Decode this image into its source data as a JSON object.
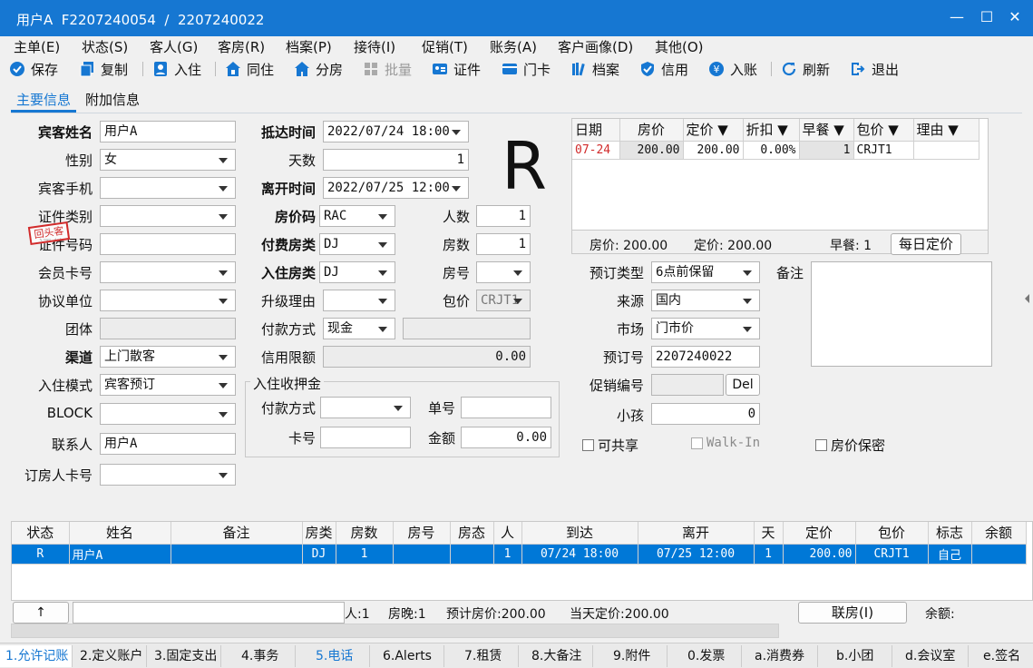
{
  "window": {
    "title": "用户A  F2207240054  /  2207240022",
    "min": "—",
    "max": "☐",
    "close": "✕"
  },
  "menu": [
    "主单(E)",
    "状态(S)",
    "客人(G)",
    "客房(R)",
    "档案(P)",
    "接待(I)",
    "促销(T)",
    "账务(A)",
    "客户画像(D)",
    "其他(O)"
  ],
  "toolbar": {
    "save": "保存",
    "copy": "复制",
    "checkin": "入住",
    "share": "同住",
    "split": "分房",
    "batch": "批量",
    "certificate": "证件",
    "card": "门卡",
    "profile": "档案",
    "credit": "信用",
    "post": "入账",
    "refresh": "刷新",
    "exit": "退出"
  },
  "tabs": {
    "main": "主要信息",
    "extra": "附加信息"
  },
  "form": {
    "guest_name_label": "宾客姓名",
    "guest_name": "用户A",
    "gender_label": "性别",
    "gender": "女",
    "phone_label": "宾客手机",
    "phone": "",
    "idtype_label": "证件类别",
    "idtype": "",
    "idno_label": "证件号码",
    "idno": "",
    "member_label": "会员卡号",
    "member": "",
    "company_label": "协议单位",
    "company": "",
    "group_label": "团体",
    "group": "",
    "channel_label": "渠道",
    "channel": "上门散客",
    "mode_label": "入住模式",
    "mode": "宾客预订",
    "block_label": "BLOCK",
    "block": "",
    "contact_label": "联系人",
    "contact": "用户A",
    "booker_label": "订房人卡号",
    "booker": "",
    "arrive_label": "抵达时间",
    "arrive": "2022/07/24 18:00",
    "days_label": "天数",
    "days": "1",
    "depart_label": "离开时间",
    "depart": "2022/07/25 12:00",
    "ratecode_label": "房价码",
    "ratecode": "RAC",
    "persons_label": "人数",
    "persons": "1",
    "paytype_label": "付费房类",
    "paytype": "DJ",
    "rooms_label": "房数",
    "rooms": "1",
    "roomtype_label": "入住房类",
    "roomtype": "DJ",
    "roomno_label": "房号",
    "roomno": "",
    "upgrade_label": "升级理由",
    "upgrade": "",
    "package_label": "包价",
    "package": "CRJT1",
    "payment_label": "付款方式",
    "payment": "现金",
    "payment_extra": "",
    "creditlimit_label": "信用限额",
    "creditlimit": "0.00",
    "deposit_title": "入住收押金",
    "dep_pay_label": "付款方式",
    "dep_pay": "",
    "dep_bill_label": "单号",
    "dep_bill": "",
    "dep_card_label": "卡号",
    "dep_card": "",
    "dep_amount_label": "金额",
    "dep_amount": "0.00",
    "status_letter": "R",
    "stamp": "回头客"
  },
  "rate_grid": {
    "headers": [
      "日期",
      "房价",
      "定价 ▼",
      "折扣 ▼",
      "早餐 ▼",
      "包价 ▼",
      "理由 ▼"
    ],
    "row": [
      "07-24",
      "200.00",
      "200.00",
      "0.00%",
      "1",
      "CRJT1",
      ""
    ],
    "summary_rate": "房价: 200.00",
    "summary_fixed": "定价: 200.00",
    "summary_breakfast": "早餐: 1",
    "daily_button": "每日定价"
  },
  "right": {
    "booktype_label": "预订类型",
    "booktype": "6点前保留",
    "remark_label": "备注",
    "remark": "",
    "source_label": "来源",
    "source": "国内",
    "market_label": "市场",
    "market": "门市价",
    "resno_label": "预订号",
    "resno": "2207240022",
    "promo_label": "促销编号",
    "promo": "",
    "del_button": "Del",
    "child_label": "小孩",
    "child": "0",
    "share_chk": "可共享",
    "walkin_chk": "Walk-In",
    "secret_chk": "房价保密"
  },
  "list": {
    "headers": [
      "状态",
      "姓名",
      "备注",
      "房类",
      "房数",
      "房号",
      "房态",
      "人",
      "到达",
      "离开",
      "天",
      "定价",
      "包价",
      "标志",
      "余额"
    ],
    "row": [
      "R",
      "用户A",
      "",
      "DJ",
      "1",
      "",
      "",
      "1",
      "07/24 18:00",
      "07/25 12:00",
      "1",
      "200.00",
      "CRJT1",
      "自己",
      ""
    ]
  },
  "footer": {
    "up": "↑",
    "persons": "人:1",
    "nights": "房晚:1",
    "est": "预计房价:200.00",
    "today": "当天定价:200.00",
    "link": "联房(I)",
    "balance": "余额:"
  },
  "bottom_tabs": [
    "1.允许记账",
    "2.定义账户",
    "3.固定支出",
    "4.事务",
    "5.电话",
    "6.Alerts",
    "7.租赁",
    "8.大备注",
    "9.附件",
    "0.发票",
    "a.消费券",
    "b.小团",
    "d.会议室",
    "e.签名"
  ],
  "colors": {
    "title": "#1677d2",
    "accent": "#1677d2",
    "selected": "#0078d7",
    "red": "#d12b2b"
  }
}
